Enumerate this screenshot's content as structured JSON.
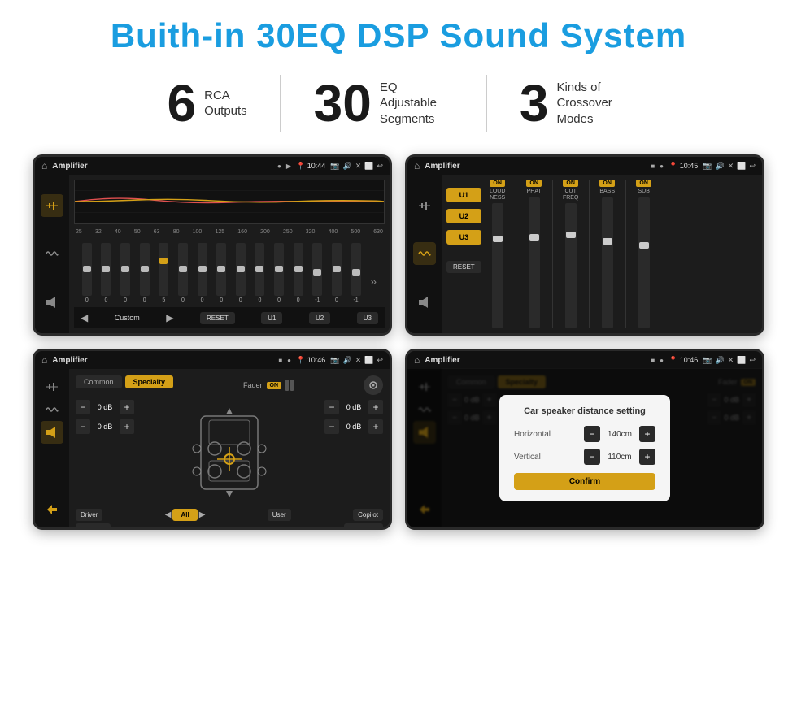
{
  "header": {
    "title": "Buith-in 30EQ DSP Sound System"
  },
  "stats": [
    {
      "number": "6",
      "label": "RCA\nOutputs"
    },
    {
      "number": "30",
      "label": "EQ Adjustable\nSegments"
    },
    {
      "number": "3",
      "label": "Kinds of\nCrossover Modes"
    }
  ],
  "screens": [
    {
      "id": "eq-screen",
      "status": {
        "title": "Amplifier",
        "time": "10:44"
      },
      "type": "equalizer"
    },
    {
      "id": "crossover-screen",
      "status": {
        "title": "Amplifier",
        "time": "10:45"
      },
      "type": "crossover"
    },
    {
      "id": "fader-screen",
      "status": {
        "title": "Amplifier",
        "time": "10:46"
      },
      "type": "fader"
    },
    {
      "id": "distance-screen",
      "status": {
        "title": "Amplifier",
        "time": "10:46"
      },
      "type": "distance",
      "dialog": {
        "title": "Car speaker distance setting",
        "horizontal_label": "Horizontal",
        "horizontal_value": "140cm",
        "vertical_label": "Vertical",
        "vertical_value": "110cm",
        "confirm_label": "Confirm"
      }
    }
  ],
  "eq": {
    "freqs": [
      "25",
      "32",
      "40",
      "50",
      "63",
      "80",
      "100",
      "125",
      "160",
      "200",
      "250",
      "320",
      "400",
      "500",
      "630"
    ],
    "values": [
      "0",
      "0",
      "0",
      "0",
      "5",
      "0",
      "0",
      "0",
      "0",
      "0",
      "0",
      "0",
      "-1",
      "0",
      "-1"
    ],
    "preset": "Custom",
    "buttons": [
      "RESET",
      "U1",
      "U2",
      "U3"
    ]
  },
  "crossover": {
    "u_buttons": [
      "U1",
      "U2",
      "U3"
    ],
    "channels": [
      {
        "on": true,
        "label": "LOUDNESS"
      },
      {
        "on": true,
        "label": "PHAT"
      },
      {
        "on": true,
        "label": "CUT FREQ"
      },
      {
        "on": true,
        "label": "BASS"
      },
      {
        "on": true,
        "label": "SUB"
      }
    ],
    "reset_label": "RESET"
  },
  "fader": {
    "tabs": [
      "Common",
      "Specialty"
    ],
    "active_tab": "Specialty",
    "fader_label": "Fader",
    "on_label": "ON",
    "db_values": [
      "0 dB",
      "0 dB",
      "0 dB",
      "0 dB"
    ],
    "bottom_buttons": [
      "Driver",
      "All",
      "User",
      "Copilot",
      "RearLeft",
      "RearRight"
    ]
  },
  "distance_dialog": {
    "title": "Car speaker distance setting",
    "horizontal": "140cm",
    "vertical": "110cm",
    "confirm": "Confirm"
  }
}
